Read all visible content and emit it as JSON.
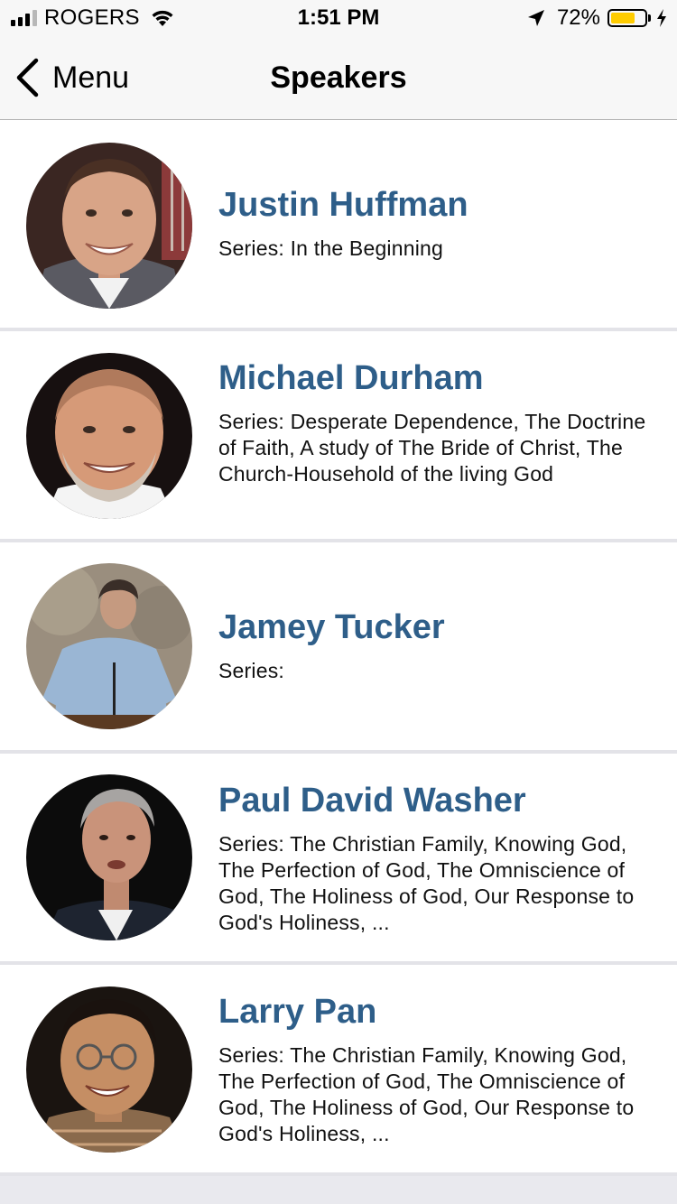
{
  "status_bar": {
    "carrier": "ROGERS",
    "time": "1:51 PM",
    "battery_percent": "72%",
    "battery_level": 0.72,
    "battery_color": "#ffcc00",
    "icons": [
      "signal-icon",
      "wifi-icon",
      "location-arrow-icon",
      "battery-icon",
      "charging-bolt-icon"
    ]
  },
  "nav": {
    "back_label": "Menu",
    "title": "Speakers",
    "back_icon": "chevron-left-icon"
  },
  "colors": {
    "name_accent": "#2e5e89",
    "separator": "#e3e3e8",
    "background": "#e9e9ee"
  },
  "speakers": [
    {
      "name": "Justin Huffman",
      "series": "Series: In the Beginning"
    },
    {
      "name": "Michael Durham",
      "series": "Series: Desperate Dependence, The Doctrine of Faith, A study of The Bride of Christ, The Church-Household of the living God"
    },
    {
      "name": "Jamey Tucker",
      "series": "Series:"
    },
    {
      "name": "Paul David Washer",
      "series": "Series: The Christian Family, Knowing God, The Perfection of God, The Omniscience of God, The Holiness of God, Our Response to God's Holiness, ..."
    },
    {
      "name": "Larry Pan",
      "series": "Series: The Christian Family, Knowing God, The Perfection of God, The Omniscience of God, The Holiness of God, Our Response to God's Holiness, ..."
    }
  ]
}
